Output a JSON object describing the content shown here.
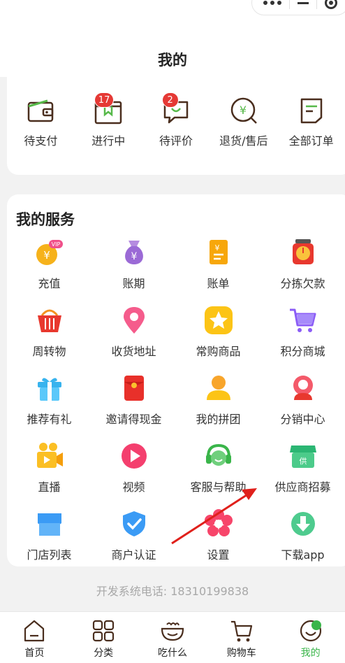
{
  "header": {
    "title": "我的"
  },
  "orders": [
    {
      "label": "待支付",
      "icon": "wallet-icon",
      "badge": null
    },
    {
      "label": "进行中",
      "icon": "box-icon",
      "badge": "17"
    },
    {
      "label": "待评价",
      "icon": "comment-icon",
      "badge": "2"
    },
    {
      "label": "退货/售后",
      "icon": "refund-icon",
      "badge": null
    },
    {
      "label": "全部订单",
      "icon": "order-list-icon",
      "badge": null
    }
  ],
  "services": {
    "title": "我的服务",
    "items": [
      {
        "label": "充值",
        "icon": "recharge-vip-icon"
      },
      {
        "label": "账期",
        "icon": "money-bag-icon"
      },
      {
        "label": "账单",
        "icon": "bill-icon"
      },
      {
        "label": "分拣欠款",
        "icon": "scale-icon"
      },
      {
        "label": "周转物",
        "icon": "basket-icon"
      },
      {
        "label": "收货地址",
        "icon": "location-pin-icon"
      },
      {
        "label": "常购商品",
        "icon": "star-icon"
      },
      {
        "label": "积分商城",
        "icon": "cart-icon"
      },
      {
        "label": "推荐有礼",
        "icon": "gift-icon"
      },
      {
        "label": "邀请得现金",
        "icon": "red-envelope-icon"
      },
      {
        "label": "我的拼团",
        "icon": "group-user-icon"
      },
      {
        "label": "分销中心",
        "icon": "distribution-icon"
      },
      {
        "label": "直播",
        "icon": "live-camera-icon"
      },
      {
        "label": "视频",
        "icon": "video-play-icon"
      },
      {
        "label": "客服与帮助",
        "icon": "headset-icon"
      },
      {
        "label": "供应商招募",
        "icon": "supplier-store-icon"
      },
      {
        "label": "门店列表",
        "icon": "store-icon"
      },
      {
        "label": "商户认证",
        "icon": "shield-check-icon"
      },
      {
        "label": "设置",
        "icon": "settings-flower-icon"
      },
      {
        "label": "下载app",
        "icon": "download-icon"
      }
    ]
  },
  "footer": {
    "phone": "开发系统电话: 18310199838"
  },
  "tabbar": [
    {
      "label": "首页",
      "icon": "home-icon",
      "active": false
    },
    {
      "label": "分类",
      "icon": "category-icon",
      "active": false
    },
    {
      "label": "吃什么",
      "icon": "bowl-icon",
      "active": false
    },
    {
      "label": "购物车",
      "icon": "shopping-cart-icon",
      "active": false
    },
    {
      "label": "我的",
      "icon": "profile-icon",
      "active": true
    }
  ],
  "colors": {
    "accent_green": "#3ab54a",
    "badge_red": "#e53935",
    "arrow_red": "#e0201b"
  }
}
